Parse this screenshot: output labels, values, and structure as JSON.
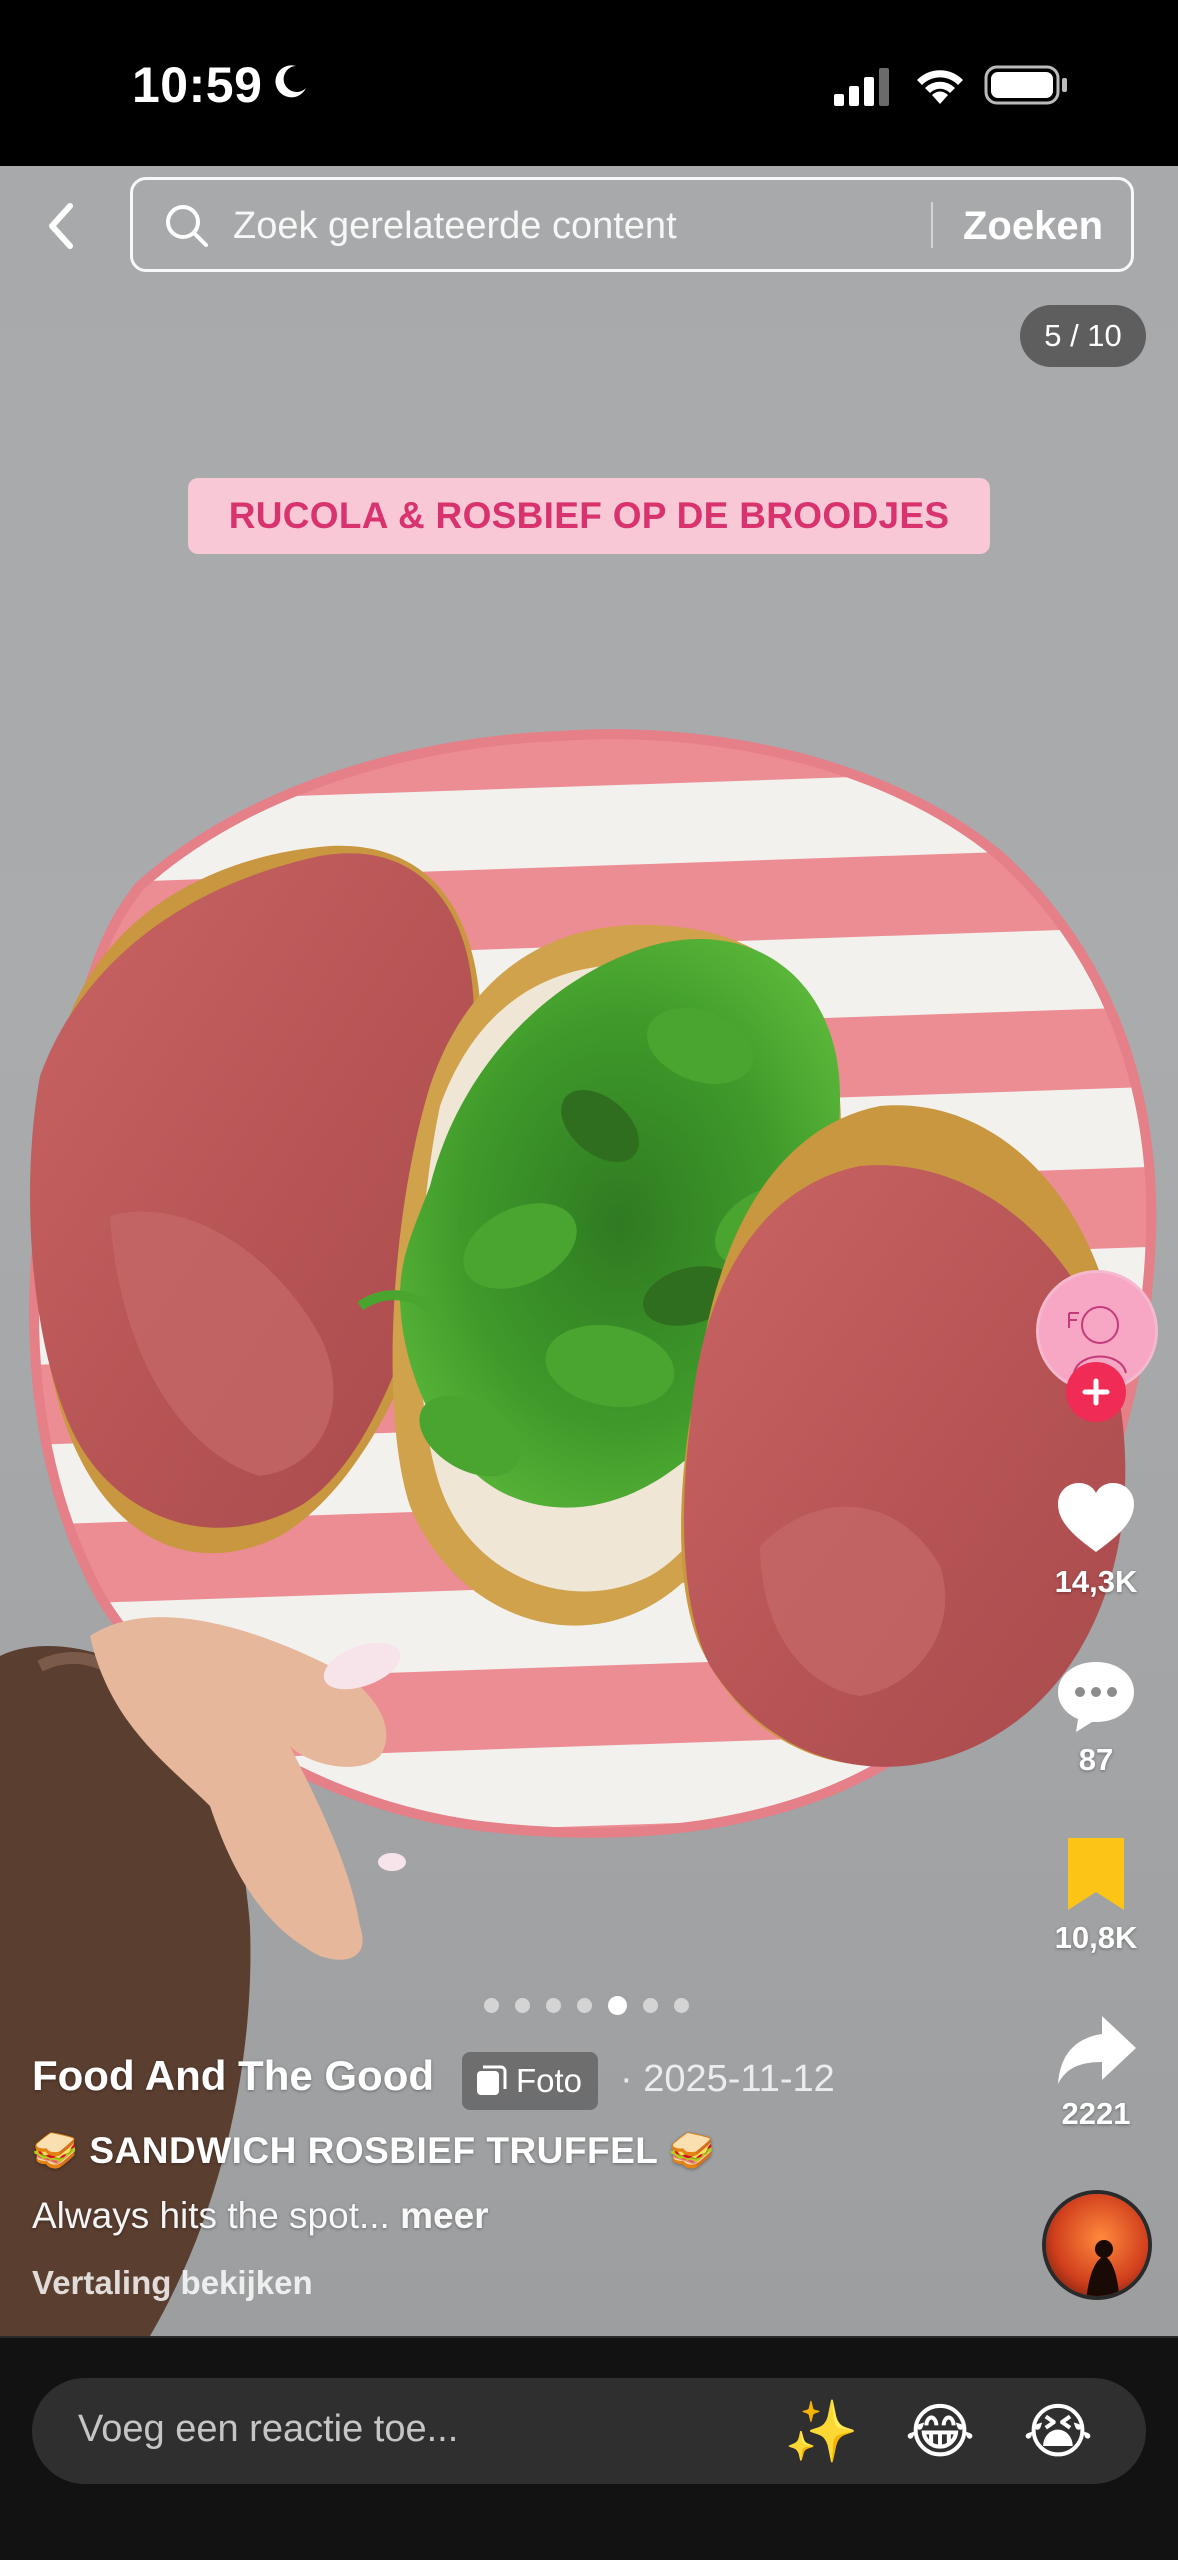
{
  "status_bar": {
    "time": "10:59",
    "icons": [
      "moon-icon",
      "cellular-signal-icon",
      "wifi-icon",
      "battery-icon"
    ]
  },
  "search": {
    "placeholder": "Zoek gerelateerde content",
    "submit_label": "Zoeken"
  },
  "carousel": {
    "counter": "5 / 10",
    "dots_total": 7,
    "active_dot": 5
  },
  "overlay": {
    "title": "RUCOLA & ROSBIEF OP DE BROODJES"
  },
  "actions": {
    "likes": "14,3K",
    "comments": "87",
    "saves": "10,8K",
    "shares": "2221"
  },
  "post": {
    "author": "Food And The Good",
    "type_badge": "Foto",
    "date": "· 2025-11-12",
    "title": "🥪 SANDWICH ROSBIEF TRUFFEL 🥪",
    "text": "Always hits the spot...",
    "more": "meer",
    "translate": "Vertaling bekijken"
  },
  "comment_bar": {
    "placeholder": "Voeg een reactie toe...",
    "emojis": [
      "✨",
      "😂",
      "😭"
    ]
  },
  "colors": {
    "follow_plus": "#f02c56",
    "bookmark": "#fbc417",
    "overlay_bg": "#f8c8d6",
    "overlay_text": "#d8336e"
  }
}
